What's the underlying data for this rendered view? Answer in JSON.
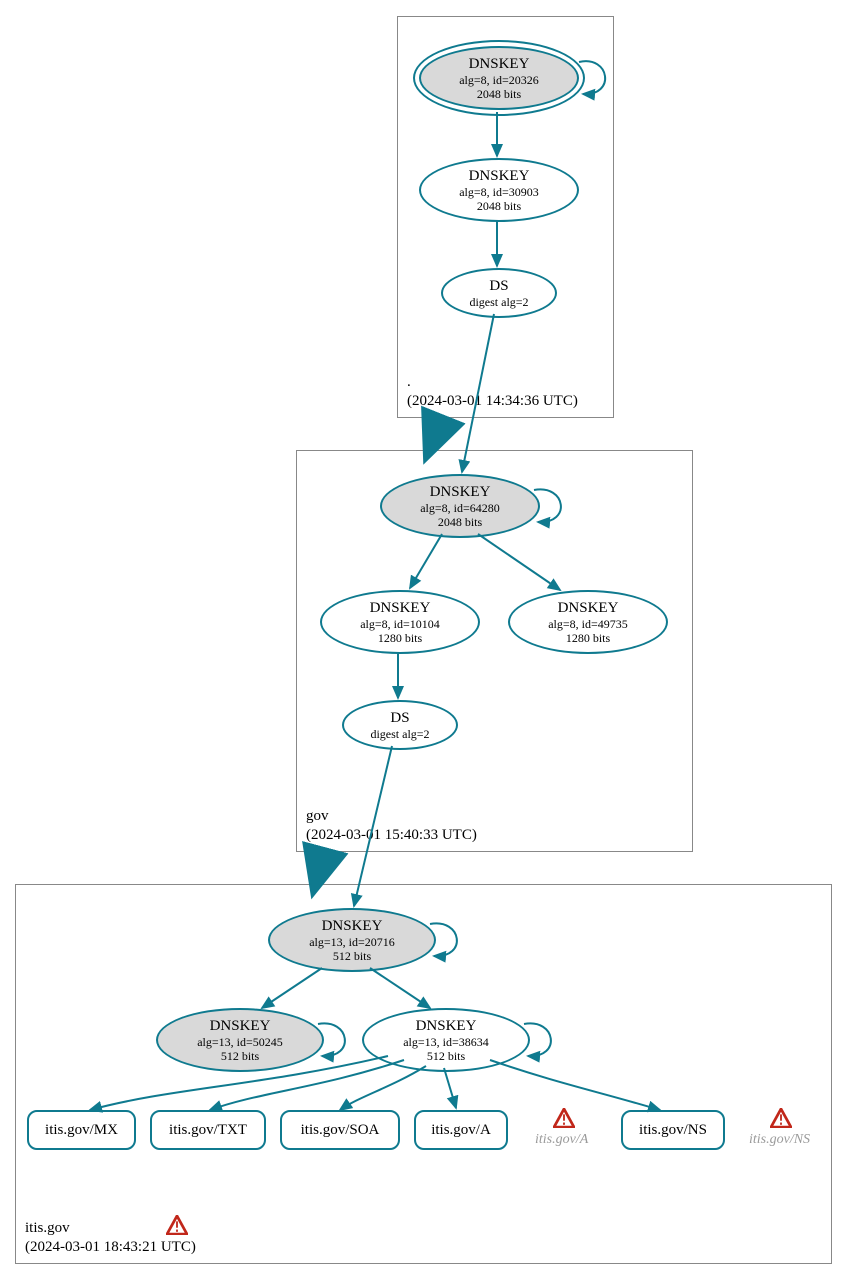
{
  "zones": {
    "root": {
      "name": ".",
      "timestamp": "(2024-03-01 14:34:36 UTC)"
    },
    "gov": {
      "name": "gov",
      "timestamp": "(2024-03-01 15:40:33 UTC)"
    },
    "itis": {
      "name": "itis.gov",
      "timestamp": "(2024-03-01 18:43:21 UTC)"
    }
  },
  "nodes": {
    "root_ksk": {
      "t": "DNSKEY",
      "l1": "alg=8, id=20326",
      "l2": "2048 bits"
    },
    "root_zsk": {
      "t": "DNSKEY",
      "l1": "alg=8, id=30903",
      "l2": "2048 bits"
    },
    "root_ds": {
      "t": "DS",
      "l1": "digest alg=2"
    },
    "gov_ksk": {
      "t": "DNSKEY",
      "l1": "alg=8, id=64280",
      "l2": "2048 bits"
    },
    "gov_zsk1": {
      "t": "DNSKEY",
      "l1": "alg=8, id=10104",
      "l2": "1280 bits"
    },
    "gov_zsk2": {
      "t": "DNSKEY",
      "l1": "alg=8, id=49735",
      "l2": "1280 bits"
    },
    "gov_ds": {
      "t": "DS",
      "l1": "digest alg=2"
    },
    "itis_ksk": {
      "t": "DNSKEY",
      "l1": "alg=13, id=20716",
      "l2": "512 bits"
    },
    "itis_zsk1": {
      "t": "DNSKEY",
      "l1": "alg=13, id=50245",
      "l2": "512 bits"
    },
    "itis_zsk2": {
      "t": "DNSKEY",
      "l1": "alg=13, id=38634",
      "l2": "512 bits"
    }
  },
  "rr": {
    "mx": "itis.gov/MX",
    "txt": "itis.gov/TXT",
    "soa": "itis.gov/SOA",
    "a": "itis.gov/A",
    "ns": "itis.gov/NS",
    "a_warn": "itis.gov/A",
    "ns_warn": "itis.gov/NS"
  },
  "colors": {
    "stroke": "#0f7a8f",
    "fill": "#d9d9d9"
  }
}
